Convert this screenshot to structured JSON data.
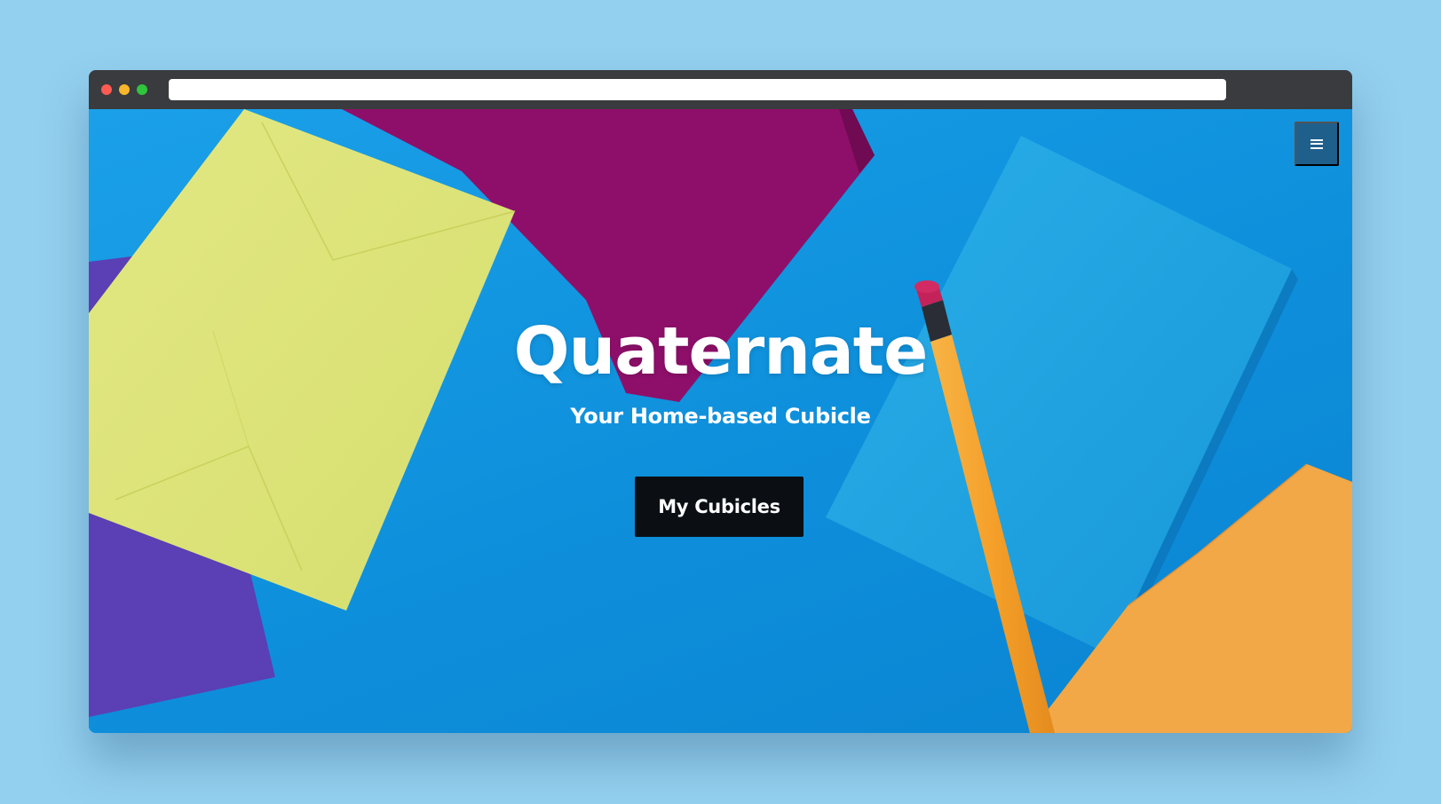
{
  "window": {
    "controls": [
      "close-dot",
      "minimize-dot",
      "maximize-dot"
    ],
    "url": ""
  },
  "hero": {
    "title": "Quaternate",
    "tagline": "Your Home-based Cubicle",
    "cta_label": "My Cubicles"
  },
  "nav": {
    "menu_icon": "hamburger-menu-icon"
  },
  "colors": {
    "page_background": "#93cfee",
    "hero_blue": "#0f8fdc",
    "menu_button": "#1f5f8c",
    "cta_button": "#0b0f14",
    "envelope_yellow": "#dfe57a",
    "envelope_purple": "#5b3fb4",
    "envelope_magenta": "#8e0f6a",
    "envelope_light_blue": "#21a6e3",
    "envelope_orange": "#f2a846",
    "pencil_orange": "#f5a02a"
  }
}
